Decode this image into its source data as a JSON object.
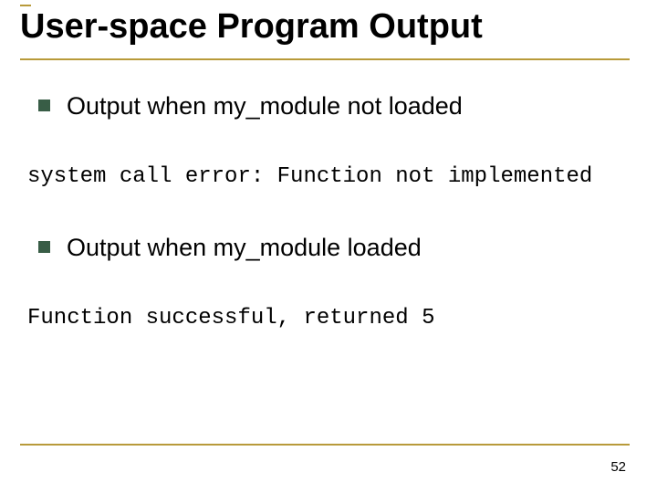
{
  "title": "User-space Program Output",
  "bullets": [
    {
      "text": "Output when my_module not loaded"
    },
    {
      "text": "Output when my_module loaded"
    }
  ],
  "outputs": [
    "system call error: Function not implemented",
    "Function successful, returned 5"
  ],
  "page_number": "52",
  "colors": {
    "accent_rule": "#b89a3a",
    "bullet": "#385d46"
  }
}
